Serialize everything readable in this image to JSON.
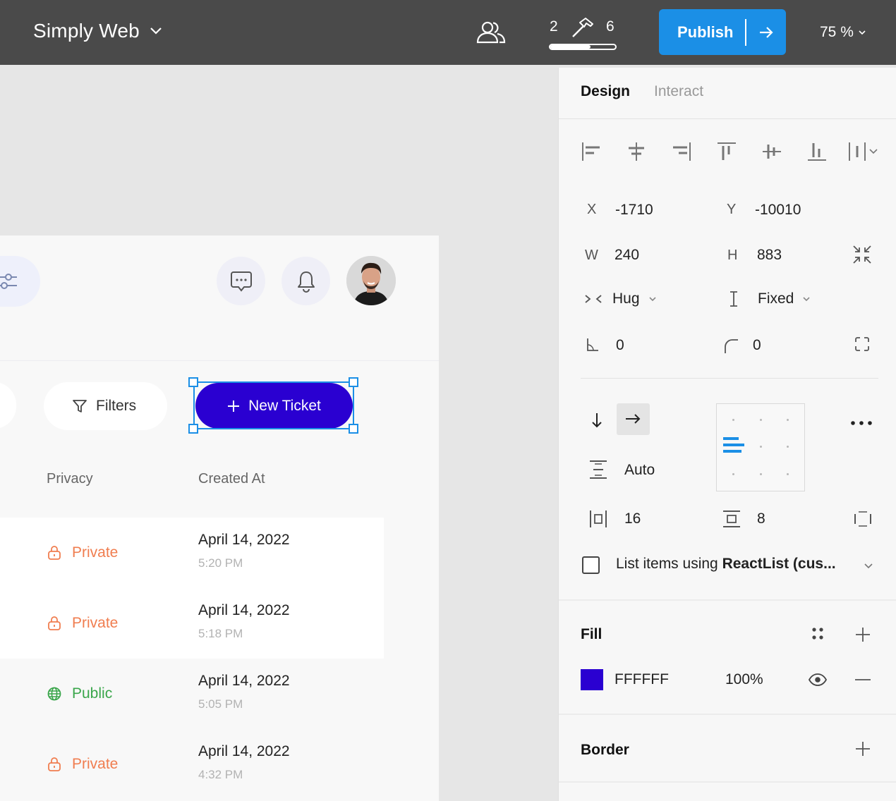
{
  "topbar": {
    "project_name": "Simply Web",
    "build_left": "2",
    "build_right": "6",
    "build_progress": 0.62,
    "publish_label": "Publish",
    "zoom": "75 %"
  },
  "card": {
    "filters_label": "Filters",
    "new_ticket_label": "New Ticket",
    "columns": {
      "privacy": "Privacy",
      "created_at": "Created At"
    },
    "rows": [
      {
        "privacy": "Private",
        "date": "April 14, 2022",
        "time": "5:20 PM"
      },
      {
        "privacy": "Private",
        "date": "April 14, 2022",
        "time": "5:18 PM"
      },
      {
        "privacy": "Public",
        "date": "April 14, 2022",
        "time": "5:05 PM"
      },
      {
        "privacy": "Private",
        "date": "April 14, 2022",
        "time": "4:32 PM"
      }
    ],
    "colors": {
      "private": "#f07d4f",
      "public": "#3aa64b",
      "primary": "#2a00d1"
    }
  },
  "panel": {
    "tabs": {
      "design": "Design",
      "interact": "Interact"
    },
    "position": {
      "x_label": "X",
      "x_value": "-1710",
      "y_label": "Y",
      "y_value": "-10010"
    },
    "size": {
      "w_label": "W",
      "w_value": "240",
      "h_label": "H",
      "h_value": "883"
    },
    "resizing": {
      "horizontal": "Hug",
      "vertical": "Fixed"
    },
    "rotation": "0",
    "radius": "0",
    "layout": {
      "spacing_mode": "Auto",
      "padding_h": "16",
      "padding_v": "8"
    },
    "list_items": {
      "prefix": "List items using ",
      "component": "ReactList (cus..."
    },
    "fill": {
      "title": "Fill",
      "hex": "FFFFFF",
      "opacity": "100%",
      "swatch_color": "#2a00d1"
    },
    "border": {
      "title": "Border"
    }
  }
}
